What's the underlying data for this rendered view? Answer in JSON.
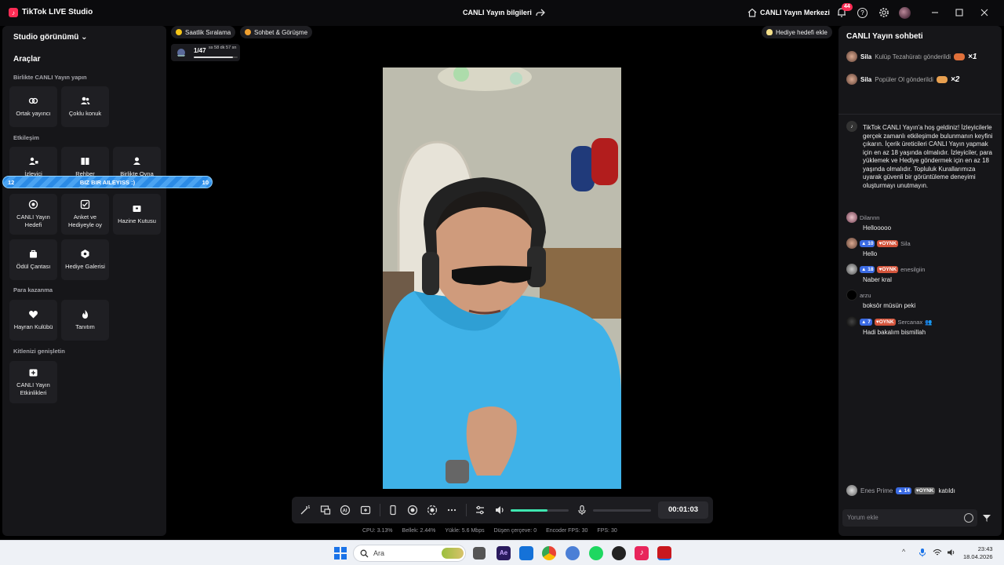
{
  "titlebar": {
    "app_name": "TikTok LIVE Studio",
    "center_title": "CANLI Yayın bilgileri",
    "live_center": "CANLI Yayın Merkezi",
    "notification_count": "44"
  },
  "left_panel": {
    "studio_view": "Studio görünümü",
    "tools_title": "Araçlar",
    "sections": {
      "together": "Birlikte CANLI Yayın yapın",
      "engagement": "Etkileşim",
      "monetize": "Para kazanma",
      "grow": "Kitlenizi genişletin"
    },
    "tools": {
      "co_host": "Ortak yayıncı",
      "multi_guest": "Çoklu konuk",
      "viewer": "İzleyici",
      "guide": "Rehber",
      "play_together": "Birlikte Oyna",
      "live_goal": "CANLI Yayın Hedefi",
      "poll": "Anket ve Hediyeyle oy",
      "treasure": "Hazine Kutusu",
      "reward_bag": "Ödül Çantası",
      "gift_gallery": "Hediye Galerisi",
      "fan_club": "Hayran Kulübü",
      "promo": "Tanıtım",
      "live_events": "CANLI Yayın Etkinlikleri"
    },
    "banner": {
      "left": "12",
      "text": "BIZ BIR AILEYISS :)",
      "right": "10"
    }
  },
  "center": {
    "hourly_ranking": "Saatlik Sıralama",
    "chat_call": "Sohbet & Görüşme",
    "gift_goal": "Hediye hedefi ekle",
    "rank": "1/47",
    "rank_timer": "ss 58 dk 57 sn",
    "rank_progress": 0.9,
    "volume_level": 0.63,
    "timer": "00:01:03"
  },
  "stats": {
    "cpu_label": "CPU:",
    "cpu": "3.13%",
    "mem_label": "Bellek:",
    "mem": "2.44%",
    "upload_label": "Yükle:",
    "upload": "5.6 Mbps",
    "dropped_label": "Düşen çerçeve:",
    "dropped": "0",
    "encoder_label": "Encoder FPS:",
    "encoder": "30",
    "fps_label": "FPS:",
    "fps": "30"
  },
  "chat": {
    "title": "CANLI Yayın sohbeti",
    "gifts": [
      {
        "user": "Sila",
        "action": "Kulüp Tezahüratı gönderildi",
        "mult": "×1"
      },
      {
        "user": "Sila",
        "action": "Popüler Ol gönderildi",
        "mult": "×2"
      }
    ],
    "welcome": "TikTok CANLI Yayın'a hoş geldiniz! İzleyicilerle gerçek zamanlı etkileşimde bulunmanın keyfini çıkarın. İçerik üreticileri CANLI Yayın yapmak için en az 18 yaşında olmalıdır. İzleyiciler, para yüklemek ve Hediye göndermek için en az 18 yaşında olmalıdır. Topluluk Kurallarımıza uyarak güvenli bir görüntüleme deneyimi oluşturmayı unutmayın.",
    "messages": [
      {
        "user": "Dilannn",
        "text": "Hellooooo"
      },
      {
        "level": "10",
        "fan": "OYNK",
        "user": "Sila",
        "text": "Hello"
      },
      {
        "level": "18",
        "fan": "OYNK",
        "user": "enesilgiin",
        "text": "Naber kral"
      },
      {
        "user": "arzu",
        "text": "boksör müsün peki"
      },
      {
        "level": "7",
        "fan": "OYNK",
        "user": "Sercanax",
        "text": "Hadi bakalım bismillah"
      }
    ],
    "join": {
      "user": "Enes Prime",
      "level": "14",
      "fan": "OYNK",
      "text": "katıldı"
    },
    "comment_placeholder": "Yorum ekle"
  },
  "taskbar": {
    "search_placeholder": "Ara",
    "time": "23:43",
    "date": "18.04.2026"
  },
  "colors": {
    "accent": "#fe2c55",
    "volume": "#3ee6b0",
    "banner": "#2b8be6",
    "level_badge": "#3b6be3",
    "fan_badge": "#d4553c"
  }
}
